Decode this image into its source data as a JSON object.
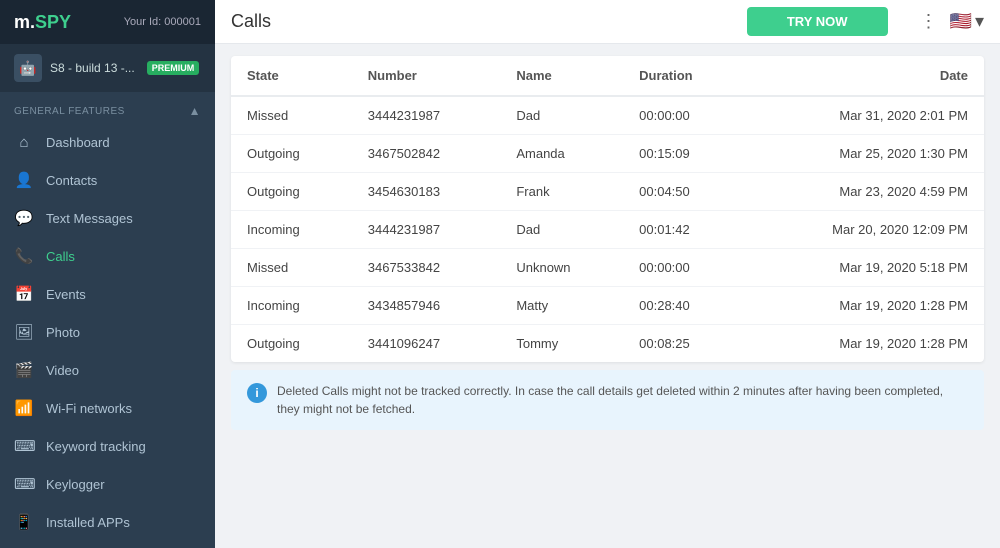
{
  "logo": {
    "m": "m",
    "spy": "SPY"
  },
  "header": {
    "your_id_label": "Your Id: 000001",
    "try_now_label": "TRY NOW",
    "page_title": "Calls",
    "dots": "⋮",
    "flag_emoji": "🇺🇸",
    "chevron_down": "▾"
  },
  "device": {
    "icon": "📱",
    "name": "S8 - build 13 -...",
    "badge": "PREMIUM"
  },
  "sidebar": {
    "section_label": "GENERAL FEATURES",
    "chevron_up": "▲",
    "items": [
      {
        "id": "dashboard",
        "icon": "⌂",
        "label": "Dashboard",
        "active": false
      },
      {
        "id": "contacts",
        "icon": "👤",
        "label": "Contacts",
        "active": false
      },
      {
        "id": "text-messages",
        "icon": "💬",
        "label": "Text Messages",
        "active": false
      },
      {
        "id": "calls",
        "icon": "📞",
        "label": "Calls",
        "active": true
      },
      {
        "id": "events",
        "icon": "📅",
        "label": "Events",
        "active": false
      },
      {
        "id": "photo",
        "icon": "🖼",
        "label": "Photo",
        "active": false
      },
      {
        "id": "video",
        "icon": "🎬",
        "label": "Video",
        "active": false
      },
      {
        "id": "wifi",
        "icon": "📶",
        "label": "Wi-Fi networks",
        "active": false
      },
      {
        "id": "keyword-tracking",
        "icon": "⌨",
        "label": "Keyword tracking",
        "active": false
      },
      {
        "id": "keylogger",
        "icon": "⌨",
        "label": "Keylogger",
        "active": false
      },
      {
        "id": "installed-apps",
        "icon": "📱",
        "label": "Installed APPs",
        "active": false
      }
    ]
  },
  "table": {
    "headers": [
      "State",
      "Number",
      "Name",
      "Duration",
      "Date"
    ],
    "rows": [
      {
        "state": "Missed",
        "number": "3444231987",
        "name": "Dad",
        "duration": "00:00:00",
        "date": "Mar 31, 2020 2:01 PM"
      },
      {
        "state": "Outgoing",
        "number": "3467502842",
        "name": "Amanda",
        "duration": "00:15:09",
        "date": "Mar 25, 2020 1:30 PM"
      },
      {
        "state": "Outgoing",
        "number": "3454630183",
        "name": "Frank",
        "duration": "00:04:50",
        "date": "Mar 23, 2020 4:59 PM"
      },
      {
        "state": "Incoming",
        "number": "3444231987",
        "name": "Dad",
        "duration": "00:01:42",
        "date": "Mar 20, 2020 12:09 PM"
      },
      {
        "state": "Missed",
        "number": "3467533842",
        "name": "Unknown",
        "duration": "00:00:00",
        "date": "Mar 19, 2020 5:18 PM"
      },
      {
        "state": "Incoming",
        "number": "3434857946",
        "name": "Matty",
        "duration": "00:28:40",
        "date": "Mar 19, 2020 1:28 PM"
      },
      {
        "state": "Outgoing",
        "number": "3441096247",
        "name": "Tommy",
        "duration": "00:08:25",
        "date": "Mar 19, 2020 1:28 PM"
      }
    ]
  },
  "info_box": {
    "icon": "i",
    "text": "Deleted Calls might not be tracked correctly. In case the call details get deleted within 2 minutes after having been completed, they might not be fetched."
  }
}
